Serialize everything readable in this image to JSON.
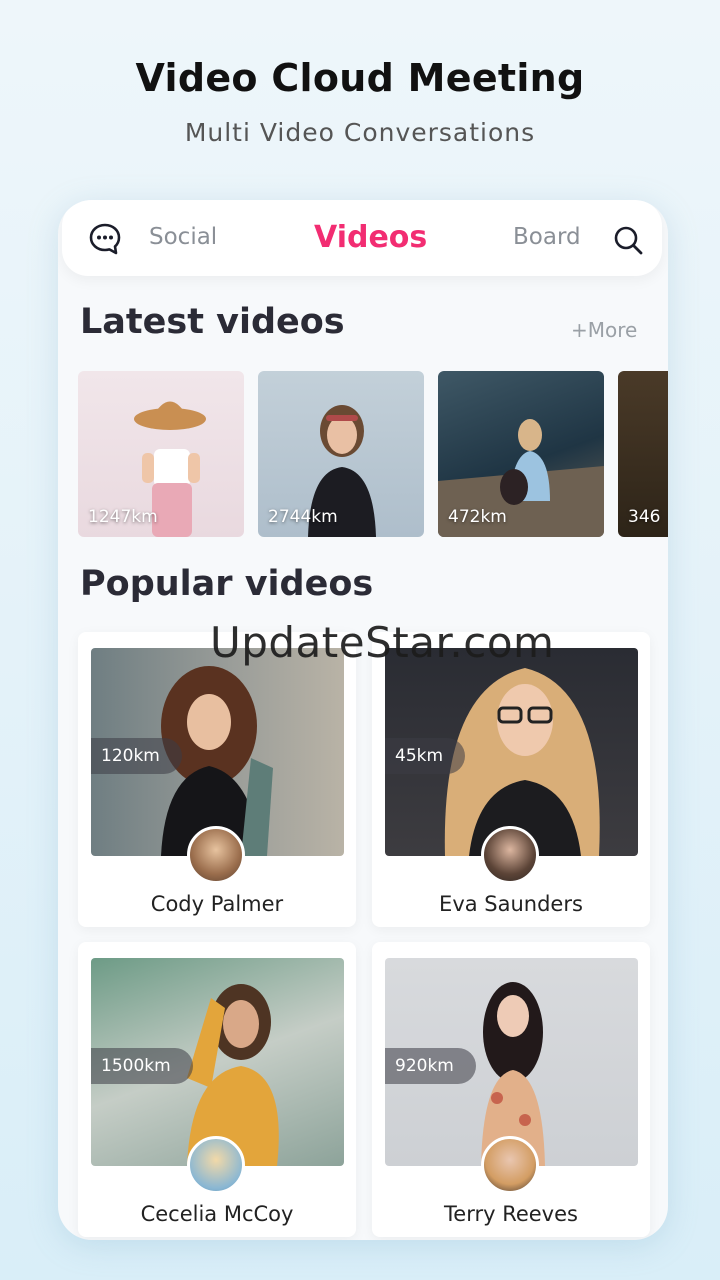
{
  "header": {
    "title": "Video Cloud Meeting",
    "subtitle": "Multi Video Conversations"
  },
  "nav": {
    "chat_icon": "chat-bubble-icon",
    "tabs": [
      {
        "label": "Social",
        "active": false
      },
      {
        "label": "Videos",
        "active": true
      },
      {
        "label": "Board",
        "active": false
      }
    ],
    "search_icon": "search-icon",
    "active_color": "#f22d72"
  },
  "latest": {
    "title": "Latest videos",
    "more_label": "+More",
    "items": [
      {
        "distance": "1247km"
      },
      {
        "distance": "2744km"
      },
      {
        "distance": "472km"
      },
      {
        "distance": "346"
      }
    ]
  },
  "popular": {
    "title": "Popular videos",
    "items": [
      {
        "distance": "120km",
        "name": "Cody Palmer"
      },
      {
        "distance": "45km",
        "name": "Eva Saunders"
      },
      {
        "distance": "1500km",
        "name": "Cecelia McCoy"
      },
      {
        "distance": "920km",
        "name": "Terry Reeves"
      }
    ]
  },
  "watermark": "UpdateStar.com"
}
